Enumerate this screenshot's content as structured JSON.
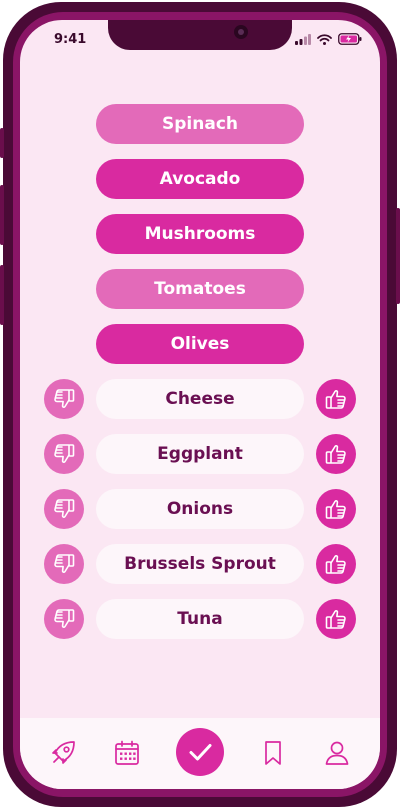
{
  "status_bar": {
    "time": "9:41"
  },
  "selected_foods": [
    {
      "label": "Spinach",
      "shade": "light"
    },
    {
      "label": "Avocado",
      "shade": "dark"
    },
    {
      "label": "Mushrooms",
      "shade": "dark"
    },
    {
      "label": "Tomatoes",
      "shade": "light"
    },
    {
      "label": "Olives",
      "shade": "dark"
    }
  ],
  "rating_foods": [
    {
      "label": "Cheese"
    },
    {
      "label": "Eggplant"
    },
    {
      "label": "Onions"
    },
    {
      "label": "Brussels Sprout"
    },
    {
      "label": "Tuna"
    }
  ],
  "icons": {
    "dislike": "thumbs-down-icon",
    "like": "thumbs-up-icon",
    "nav": [
      "rocket-icon",
      "calendar-icon",
      "check-icon",
      "bookmark-icon",
      "profile-icon"
    ]
  },
  "colors": {
    "accent": "#d92aa0",
    "accent_light": "#e36ab9",
    "background": "#fbe7f3",
    "text_dark": "#6a0f52",
    "frame": "#4a0a36"
  }
}
